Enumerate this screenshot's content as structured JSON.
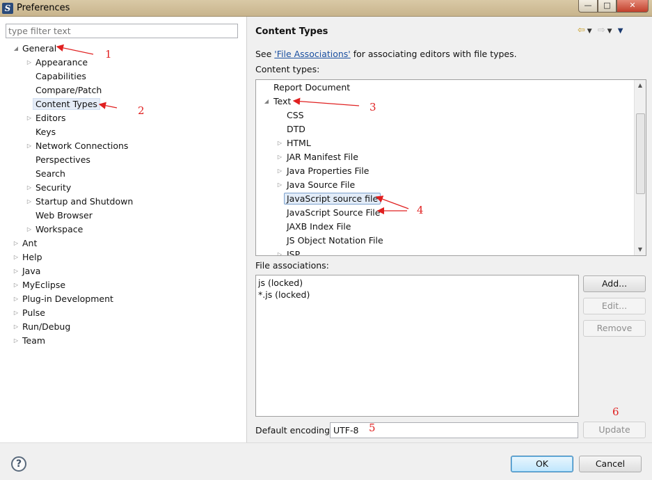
{
  "window": {
    "title": "Preferences",
    "app_icon": "eclipse-icon"
  },
  "left": {
    "filter_placeholder": "type filter text",
    "general": "General",
    "general_children": [
      "Appearance",
      "Capabilities",
      "Compare/Patch",
      "Content Types",
      "Editors",
      "Keys",
      "Network Connections",
      "Perspectives",
      "Search",
      "Security",
      "Startup and Shutdown",
      "Web Browser",
      "Workspace"
    ],
    "top_level": [
      "Ant",
      "Help",
      "Java",
      "MyEclipse",
      "Plug-in Development",
      "Pulse",
      "Run/Debug",
      "Team"
    ]
  },
  "right": {
    "title": "Content Types",
    "see_prefix": "See ",
    "see_link": "'File Associations'",
    "see_suffix": " for associating editors with file types.",
    "content_types_label": "Content types:",
    "types_tree": {
      "report": "Report Document",
      "text": "Text",
      "children": [
        "CSS",
        "DTD",
        "HTML",
        "JAR Manifest File",
        "Java Properties File",
        "Java Source File",
        "JavaScript source file",
        "JavaScript Source File",
        "JAXB Index File",
        "JS Object Notation File",
        "JSP"
      ]
    },
    "file_assoc_label": "File associations:",
    "file_assoc": [
      "js (locked)",
      "*.js (locked)"
    ],
    "buttons": {
      "add": "Add...",
      "edit": "Edit...",
      "remove": "Remove",
      "update": "Update"
    },
    "encoding_label": "Default encoding:",
    "encoding_value": "UTF-8"
  },
  "bottom": {
    "ok": "OK",
    "cancel": "Cancel",
    "help": "?"
  },
  "annotations": [
    "1",
    "2",
    "3",
    "4",
    "5",
    "6"
  ],
  "colors": {
    "annotation": "#e02020",
    "link": "#1a4fa0",
    "selection": "#e2ecf8"
  }
}
